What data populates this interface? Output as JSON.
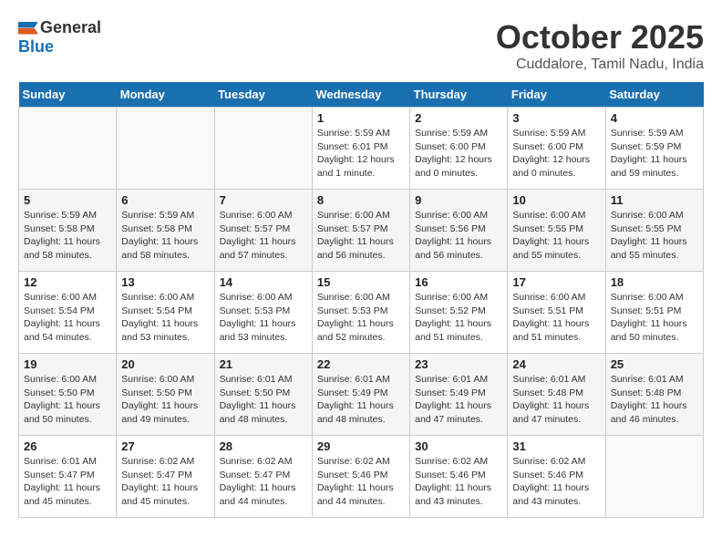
{
  "header": {
    "logo_general": "General",
    "logo_blue": "Blue",
    "title": "October 2025",
    "location": "Cuddalore, Tamil Nadu, India"
  },
  "weekdays": [
    "Sunday",
    "Monday",
    "Tuesday",
    "Wednesday",
    "Thursday",
    "Friday",
    "Saturday"
  ],
  "weeks": [
    [
      {
        "day": "",
        "empty": true
      },
      {
        "day": "",
        "empty": true
      },
      {
        "day": "",
        "empty": true
      },
      {
        "day": "1",
        "info": "Sunrise: 5:59 AM\nSunset: 6:01 PM\nDaylight: 12 hours\nand 1 minute."
      },
      {
        "day": "2",
        "info": "Sunrise: 5:59 AM\nSunset: 6:00 PM\nDaylight: 12 hours\nand 0 minutes."
      },
      {
        "day": "3",
        "info": "Sunrise: 5:59 AM\nSunset: 6:00 PM\nDaylight: 12 hours\nand 0 minutes."
      },
      {
        "day": "4",
        "info": "Sunrise: 5:59 AM\nSunset: 5:59 PM\nDaylight: 11 hours\nand 59 minutes."
      }
    ],
    [
      {
        "day": "5",
        "info": "Sunrise: 5:59 AM\nSunset: 5:58 PM\nDaylight: 11 hours\nand 58 minutes."
      },
      {
        "day": "6",
        "info": "Sunrise: 5:59 AM\nSunset: 5:58 PM\nDaylight: 11 hours\nand 58 minutes."
      },
      {
        "day": "7",
        "info": "Sunrise: 6:00 AM\nSunset: 5:57 PM\nDaylight: 11 hours\nand 57 minutes."
      },
      {
        "day": "8",
        "info": "Sunrise: 6:00 AM\nSunset: 5:57 PM\nDaylight: 11 hours\nand 56 minutes."
      },
      {
        "day": "9",
        "info": "Sunrise: 6:00 AM\nSunset: 5:56 PM\nDaylight: 11 hours\nand 56 minutes."
      },
      {
        "day": "10",
        "info": "Sunrise: 6:00 AM\nSunset: 5:55 PM\nDaylight: 11 hours\nand 55 minutes."
      },
      {
        "day": "11",
        "info": "Sunrise: 6:00 AM\nSunset: 5:55 PM\nDaylight: 11 hours\nand 55 minutes."
      }
    ],
    [
      {
        "day": "12",
        "info": "Sunrise: 6:00 AM\nSunset: 5:54 PM\nDaylight: 11 hours\nand 54 minutes."
      },
      {
        "day": "13",
        "info": "Sunrise: 6:00 AM\nSunset: 5:54 PM\nDaylight: 11 hours\nand 53 minutes."
      },
      {
        "day": "14",
        "info": "Sunrise: 6:00 AM\nSunset: 5:53 PM\nDaylight: 11 hours\nand 53 minutes."
      },
      {
        "day": "15",
        "info": "Sunrise: 6:00 AM\nSunset: 5:53 PM\nDaylight: 11 hours\nand 52 minutes."
      },
      {
        "day": "16",
        "info": "Sunrise: 6:00 AM\nSunset: 5:52 PM\nDaylight: 11 hours\nand 51 minutes."
      },
      {
        "day": "17",
        "info": "Sunrise: 6:00 AM\nSunset: 5:51 PM\nDaylight: 11 hours\nand 51 minutes."
      },
      {
        "day": "18",
        "info": "Sunrise: 6:00 AM\nSunset: 5:51 PM\nDaylight: 11 hours\nand 50 minutes."
      }
    ],
    [
      {
        "day": "19",
        "info": "Sunrise: 6:00 AM\nSunset: 5:50 PM\nDaylight: 11 hours\nand 50 minutes."
      },
      {
        "day": "20",
        "info": "Sunrise: 6:00 AM\nSunset: 5:50 PM\nDaylight: 11 hours\nand 49 minutes."
      },
      {
        "day": "21",
        "info": "Sunrise: 6:01 AM\nSunset: 5:50 PM\nDaylight: 11 hours\nand 48 minutes."
      },
      {
        "day": "22",
        "info": "Sunrise: 6:01 AM\nSunset: 5:49 PM\nDaylight: 11 hours\nand 48 minutes."
      },
      {
        "day": "23",
        "info": "Sunrise: 6:01 AM\nSunset: 5:49 PM\nDaylight: 11 hours\nand 47 minutes."
      },
      {
        "day": "24",
        "info": "Sunrise: 6:01 AM\nSunset: 5:48 PM\nDaylight: 11 hours\nand 47 minutes."
      },
      {
        "day": "25",
        "info": "Sunrise: 6:01 AM\nSunset: 5:48 PM\nDaylight: 11 hours\nand 46 minutes."
      }
    ],
    [
      {
        "day": "26",
        "info": "Sunrise: 6:01 AM\nSunset: 5:47 PM\nDaylight: 11 hours\nand 45 minutes."
      },
      {
        "day": "27",
        "info": "Sunrise: 6:02 AM\nSunset: 5:47 PM\nDaylight: 11 hours\nand 45 minutes."
      },
      {
        "day": "28",
        "info": "Sunrise: 6:02 AM\nSunset: 5:47 PM\nDaylight: 11 hours\nand 44 minutes."
      },
      {
        "day": "29",
        "info": "Sunrise: 6:02 AM\nSunset: 5:46 PM\nDaylight: 11 hours\nand 44 minutes."
      },
      {
        "day": "30",
        "info": "Sunrise: 6:02 AM\nSunset: 5:46 PM\nDaylight: 11 hours\nand 43 minutes."
      },
      {
        "day": "31",
        "info": "Sunrise: 6:02 AM\nSunset: 5:46 PM\nDaylight: 11 hours\nand 43 minutes."
      },
      {
        "day": "",
        "empty": true
      }
    ]
  ]
}
